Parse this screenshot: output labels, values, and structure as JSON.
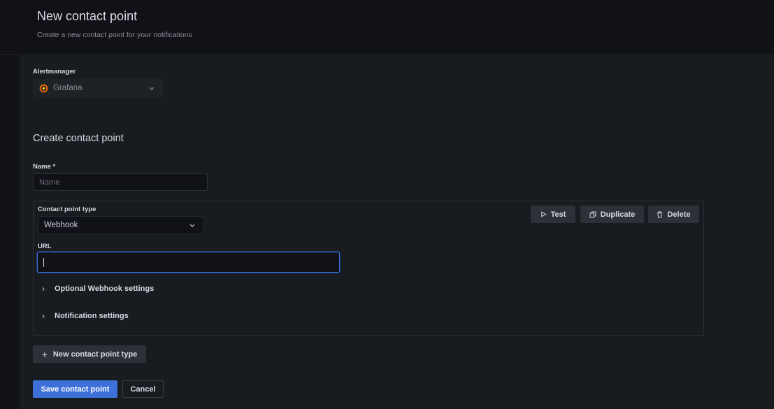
{
  "header": {
    "title": "New contact point",
    "subtitle": "Create a new contact point for your notifications"
  },
  "alertmanager": {
    "label": "Alertmanager",
    "selected": "Grafana",
    "logo_icon": "grafana-logo-icon"
  },
  "form": {
    "section_title": "Create contact point",
    "name_label": "Name *",
    "name_placeholder": "Name",
    "name_value": ""
  },
  "contact_point": {
    "type_label": "Contact point type",
    "type_selected": "Webhook",
    "url_label": "URL",
    "url_value": "",
    "test_label": "Test",
    "duplicate_label": "Duplicate",
    "delete_label": "Delete",
    "optional_settings_label": "Optional Webhook settings",
    "notification_settings_label": "Notification settings"
  },
  "actions": {
    "new_type_label": "New contact point type",
    "save_label": "Save contact point",
    "cancel_label": "Cancel"
  },
  "colors": {
    "background": "#111217",
    "panel": "#181b1f",
    "primary": "#3d71d9",
    "secondary_button": "#2d3036",
    "grafana_orange": "#f46800"
  }
}
